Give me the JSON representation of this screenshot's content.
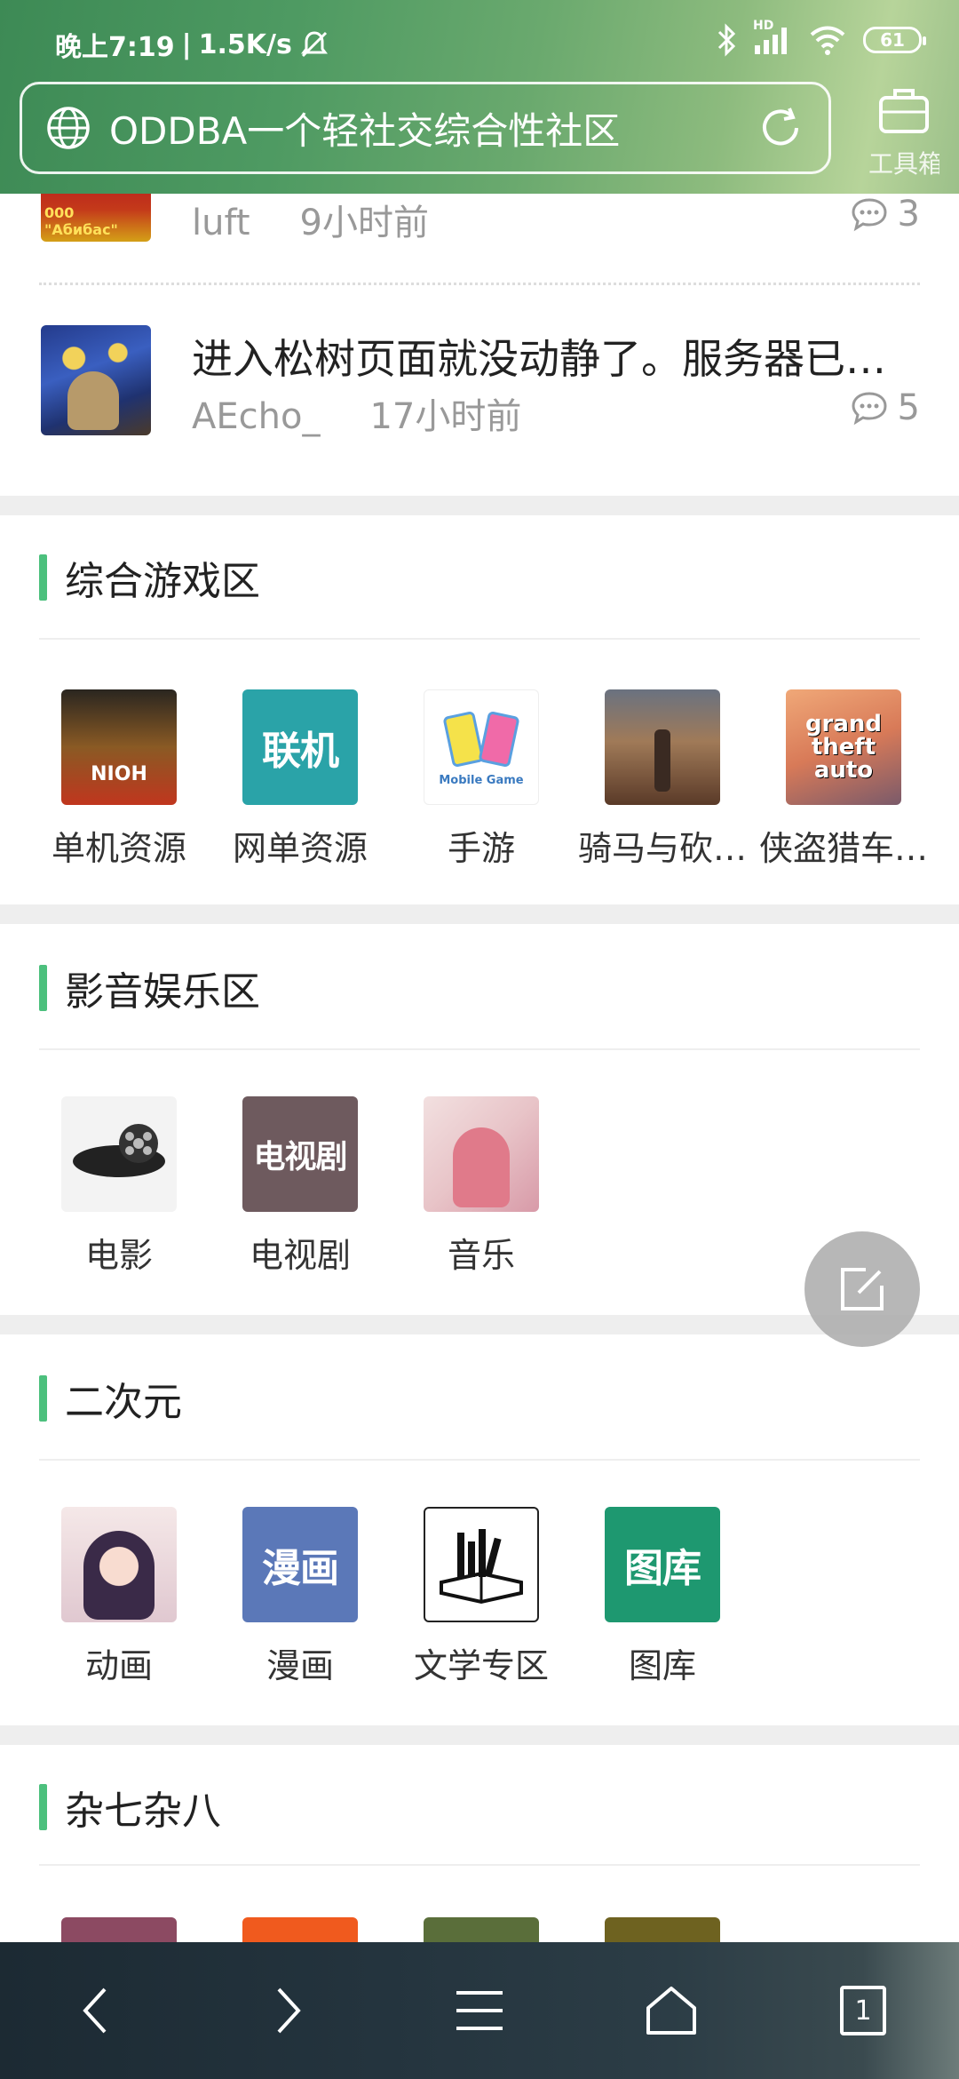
{
  "status_bar": {
    "time": "晚上7:19",
    "speed": "1.5K/s",
    "battery": "61",
    "network": "HD"
  },
  "address_bar": {
    "title": "ODDBA一个轻社交综合性社区",
    "toolbox_label": "工具箱"
  },
  "posts": [
    {
      "author": "luft",
      "time": "9小时前",
      "comments": "3",
      "title": ""
    },
    {
      "title": "进入松树页面就没动静了。服务器已经…",
      "author": "AEcho_",
      "time": "17小时前",
      "comments": "5"
    }
  ],
  "sections": [
    {
      "title": "综合游戏区",
      "items": [
        {
          "label": "单机资源",
          "icon": "nioh-game-icon"
        },
        {
          "label": "网单资源",
          "icon_text": "联机",
          "color": "#2aa3a8"
        },
        {
          "label": "手游",
          "icon_text": "Mobile Game"
        },
        {
          "label": "骑马与砍…",
          "icon": "mount-and-blade-icon"
        },
        {
          "label": "侠盗猎车…",
          "icon_text": "grand theft auto"
        }
      ]
    },
    {
      "title": "影音娱乐区",
      "items": [
        {
          "label": "电影",
          "icon": "film-reel-icon"
        },
        {
          "label": "电视剧",
          "icon_text": "电视剧",
          "color": "#6e5a5e"
        },
        {
          "label": "音乐",
          "icon": "anime-headphones-icon"
        }
      ]
    },
    {
      "title": "二次元",
      "items": [
        {
          "label": "动画",
          "icon": "anime-girl-icon"
        },
        {
          "label": "漫画",
          "icon_text": "漫画",
          "color": "#5b78b8"
        },
        {
          "label": "文学专区",
          "icon": "books-icon"
        },
        {
          "label": "图库",
          "icon_text": "图库",
          "color": "#1e9870"
        }
      ]
    },
    {
      "title": "杂七杂八",
      "items": [
        {
          "color": "#8c4a62"
        },
        {
          "color": "#f05a1e"
        },
        {
          "color": "#5a6e3a"
        },
        {
          "color": "#6e6220"
        }
      ]
    }
  ],
  "bottom_nav": {
    "tabs_count": "1"
  }
}
